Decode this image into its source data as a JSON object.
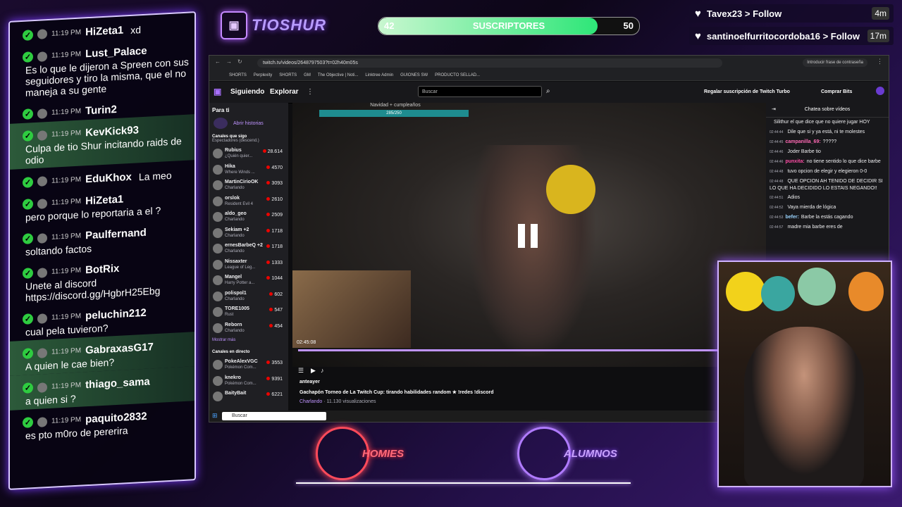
{
  "overlay": {
    "brand": "TIOSHUR",
    "subgoal": {
      "current": "42",
      "label": "SUSCRIPTORES",
      "goal": "50",
      "progress": 0.84
    },
    "follows": [
      {
        "name": "Tavex23 > Follow",
        "ago": "4m"
      },
      {
        "name": "santinoelfurritocordoba16 > Follow",
        "ago": "17m"
      }
    ],
    "chat": [
      {
        "time": "11:19 PM",
        "user": "HiZeta1",
        "text": "xd",
        "inline": true
      },
      {
        "time": "11:19 PM",
        "user": "Lust_Palace",
        "text": "Es lo que le dijeron a Spreen con sus seguidores y tiro la misma, que el no maneja a su gente"
      },
      {
        "time": "11:19 PM",
        "user": "Turin2",
        "text": ""
      },
      {
        "time": "11:19 PM",
        "user": "KevKick93",
        "text": "Culpa de tio Shur incitando raids de odio",
        "highlight": true
      },
      {
        "time": "11:19 PM",
        "user": "EduKhox",
        "text": "La meo",
        "inline": true
      },
      {
        "time": "11:19 PM",
        "user": "HiZeta1",
        "text": "pero porque lo reportaria a el ?"
      },
      {
        "time": "11:19 PM",
        "user": "Paulfernand",
        "text": "soltando factos"
      },
      {
        "time": "11:19 PM",
        "user": "BotRix",
        "text": "Unete al discord https://discord.gg/HgbrH25Ebg"
      },
      {
        "time": "11:19 PM",
        "user": "peluchin212",
        "text": "cual pela tuvieron?"
      },
      {
        "time": "11:19 PM",
        "user": "GabraxasG17",
        "text": "A quien le cae bien?",
        "highlight": true
      },
      {
        "time": "11:19 PM",
        "user": "thiago_sama",
        "text": "a quien si ?",
        "highlight": true
      },
      {
        "time": "11:19 PM",
        "user": "paquito2832",
        "text": "es pto m0ro de pererira"
      }
    ],
    "bottom_logos": [
      "HOMIES",
      "ALUMNOS"
    ]
  },
  "browser": {
    "url": "twitch.tv/videos/2648797503?t=02h40m05s",
    "bookmarks": [
      "SHORTS",
      "Perplexity",
      "SHORTS",
      "GM",
      "The Objective | Noti...",
      "Linktree Admin",
      "GUIONES SW",
      "PRODUCTO SELLAD..."
    ],
    "password_hint": "Introducir frase de contraseña",
    "nav": {
      "following": "Siguiendo",
      "explore": "Explorar",
      "search_placeholder": "Buscar",
      "turbo": "Regalar suscripción de Twitch Turbo",
      "bits": "Comprar Bits"
    },
    "sidebar": {
      "for_you": "Para ti",
      "stories": "Abrir historias",
      "followed_title": "Canales que sigo",
      "followed_sort": "Espectadores (descend.)",
      "channels": [
        {
          "name": "Rubius",
          "game": "¿Quién quier...",
          "viewers": "28.614"
        },
        {
          "name": "Hika",
          "game": "Where Winds ...",
          "viewers": "4570"
        },
        {
          "name": "MartinCirioOK",
          "game": "Charlando",
          "viewers": "3093"
        },
        {
          "name": "orslok",
          "game": "Resident Evil 4",
          "viewers": "2610"
        },
        {
          "name": "aldo_geo",
          "game": "Charlando",
          "viewers": "2509"
        },
        {
          "name": "Sekiam +2",
          "game": "Charlando",
          "viewers": "1718"
        },
        {
          "name": "ernesBarbeQ +2",
          "game": "Charlando",
          "viewers": "1718"
        },
        {
          "name": "Nissaxter",
          "game": "League of Leg...",
          "viewers": "1333"
        },
        {
          "name": "Mangel",
          "game": "Harry Potter a...",
          "viewers": "1044"
        },
        {
          "name": "polispol1",
          "game": "Charlando",
          "viewers": "602"
        },
        {
          "name": "TORE1005",
          "game": "Rust",
          "viewers": "547"
        },
        {
          "name": "Reborn",
          "game": "Charlando",
          "viewers": "454"
        }
      ],
      "show_more": "Mostrar más",
      "live_title": "Canales en directo",
      "live": [
        {
          "name": "PokeAlexVGC",
          "game": "Pokémon Com...",
          "viewers": "3553"
        },
        {
          "name": "knekro",
          "game": "Pokémon Com...",
          "viewers": "9391"
        },
        {
          "name": "BaityBait",
          "game": "",
          "viewers": "6221"
        }
      ]
    },
    "video": {
      "goal_label": "Navidad + cumpleaños",
      "goal_count": "285/250",
      "pip_time": "02:45:08"
    },
    "info": {
      "channel": "anteayer",
      "title": "Gachapón Torneo de La Twitch Cup: tirando habilidades random ★ !redes !discord",
      "category": "Charlando",
      "views": "· 11.130 visualizaciones"
    },
    "right_chat": {
      "title": "Chatea sobre vídeos",
      "messages": [
        {
          "time": "",
          "user": "",
          "text": "Silithur el que dice que no quiere jugar HOY",
          "color": "#efeff1"
        },
        {
          "time": "02:44:44",
          "user": "",
          "text": "Dile que si y ya está, ni te molestes",
          "color": "#efeff1"
        },
        {
          "time": "02:44:45",
          "user": "campanilla_69:",
          "text": "?????",
          "color": "#ff69b4"
        },
        {
          "time": "02:44:46",
          "user": "",
          "text": "Joder Barbe tio",
          "color": "#efeff1"
        },
        {
          "time": "02:44:46",
          "user": "punxita:",
          "text": "no tiene sentido lo que dice barbe",
          "color": "#ff4da6"
        },
        {
          "time": "02:44:48",
          "user": "",
          "text": "tuvo opcion de elegir y elegieron 0-0",
          "color": "#efeff1"
        },
        {
          "time": "02:44:48",
          "user": "",
          "text": "QUE OPCION AH TENIDO DE DECIDIR SI LO QUE HA DECIDIDO LO ESTAIS NEGANDO!!",
          "color": "#efeff1"
        },
        {
          "time": "02:44:51",
          "user": "",
          "text": "Adios",
          "color": "#efeff1"
        },
        {
          "time": "02:44:52",
          "user": "",
          "text": "Vaya mierda de lógica",
          "color": "#efeff1"
        },
        {
          "time": "02:44:53",
          "user": "befer:",
          "text": "Barbe la estás cagando",
          "color": "#9ad4ff"
        },
        {
          "time": "02:44:57",
          "user": "",
          "text": "madre mia barbe eres de",
          "color": "#efeff1"
        }
      ]
    },
    "taskbar_search": "Buscar"
  }
}
